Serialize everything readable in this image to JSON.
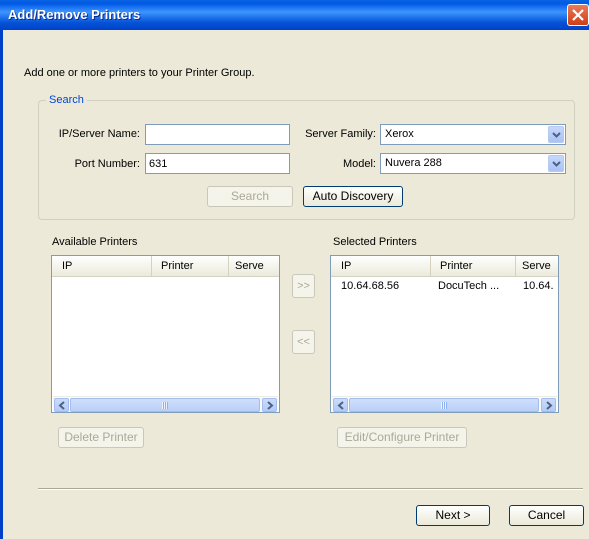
{
  "window": {
    "title": "Add/Remove Printers"
  },
  "instruction": "Add one or more printers to your Printer Group.",
  "search": {
    "legend": "Search",
    "ip_label": "IP/Server Name:",
    "ip_value": "",
    "port_label": "Port Number:",
    "port_value": "631",
    "family_label": "Server Family:",
    "family_value": "Xerox",
    "model_label": "Model:",
    "model_value": "Nuvera 288",
    "search_button": "Search",
    "auto_discovery_button": "Auto Discovery"
  },
  "available": {
    "label": "Available Printers",
    "columns": [
      "IP",
      "Printer",
      "Serve"
    ],
    "rows": [],
    "delete_button": "Delete Printer"
  },
  "selected": {
    "label": "Selected Printers",
    "columns": [
      "IP",
      "Printer",
      "Serve"
    ],
    "rows": [
      {
        "ip": "10.64.68.56",
        "printer": "DocuTech ...",
        "server": "10.64."
      }
    ],
    "edit_button": "Edit/Configure Printer"
  },
  "transfer": {
    "add_label": ">>",
    "remove_label": "<<"
  },
  "footer": {
    "next_button": "Next >",
    "cancel_button": "Cancel"
  },
  "icons": {
    "close": "close-icon",
    "dropdown": "chevron-down-icon",
    "scroll_left": "chevron-left-icon",
    "scroll_right": "chevron-right-icon"
  },
  "colors": {
    "titlebar": "#0058e6",
    "dialog_bg": "#ece9d8",
    "legend": "#0046d5",
    "close": "#cf3e15"
  }
}
